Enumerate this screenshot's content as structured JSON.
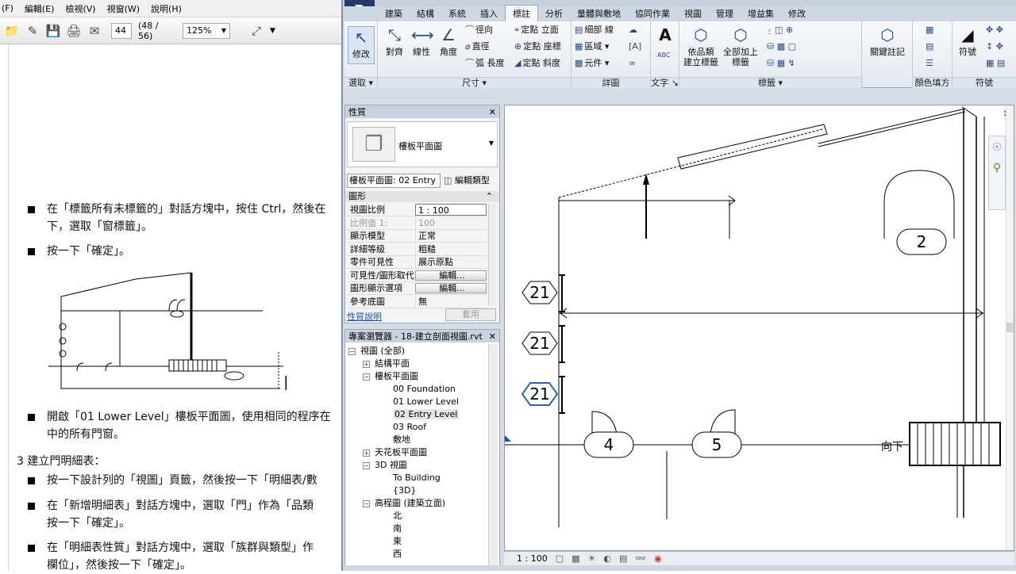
{
  "pdf": {
    "menu": [
      "(F)",
      "編輯(E)",
      "檢視(V)",
      "視窗(W)",
      "說明(H)"
    ],
    "page_number": "44",
    "page_of": "(48 / 56)",
    "zoom": "125%",
    "bullets": [
      {
        "line1": "在「標籤所有未標籤的」對話方塊中，按住 Ctrl，然後在",
        "line2": "下，選取「窗標籤」。"
      },
      {
        "line1": "按一下「確定」。",
        "line2": ""
      },
      {
        "line1": "開啟「01 Lower Level」樓板平面圖，使用相同的程序在",
        "line2": "中的所有門窗。"
      },
      {
        "line1": "按一下設計列的「視圖」頁籤，然後按一下「明細表/數",
        "line2": ""
      },
      {
        "line1": "在「新增明細表」對話方塊中，選取「門」作為「品類",
        "line2": "按一下「確定」。"
      },
      {
        "line1": "在「明細表性質」對話方塊中，選取「族群與類型」作",
        "line2": "欄位」，然後按一下「確定」。"
      }
    ],
    "section_heading": "3 建立門明細表：",
    "section_number": "3"
  },
  "revit": {
    "logo": "R",
    "tabs": [
      "建築",
      "結構",
      "系統",
      "插入",
      "標註",
      "分析",
      "量體與敷地",
      "協同作業",
      "視圖",
      "管理",
      "增益集",
      "修改"
    ],
    "active_tab": "標註",
    "ribbon": {
      "modify": "修改",
      "select": "選取 ▾",
      "dims": [
        "對齊",
        "線性",
        "角度"
      ],
      "dims_small": [
        "徑向",
        "直徑",
        "弧 長度",
        "定點 立面",
        "定點 座標",
        "定點 斜度"
      ],
      "dims_title": "尺寸 ▾",
      "detail": [
        "細部 線",
        "區域 ▾",
        "元件 ▾"
      ],
      "detail_title": "詳圖",
      "text": "文字",
      "text_title": "文字 ↘",
      "tag1": "依品類\n建立標籤",
      "tag2": "全部加上\n標籤",
      "tag_title": "標籤 ▾",
      "keynote": "關鍵註記",
      "color_fill_title": "顏色填方",
      "symbol": "符號",
      "symbol_title": "符號"
    },
    "properties": {
      "title": "性質",
      "type_name": "樓板平面圖",
      "selector": "樓板平面圖: 02 Entry",
      "edit_type": "編輯類型",
      "group": "圖形",
      "rows": [
        {
          "k": "視圖比例",
          "v": "1 : 100"
        },
        {
          "k": "比例值 1:",
          "v": "100"
        },
        {
          "k": "顯示模型",
          "v": "正常"
        },
        {
          "k": "詳細等級",
          "v": "粗糙"
        },
        {
          "k": "零件可見性",
          "v": "展示原點"
        },
        {
          "k": "可見性/圖形取代",
          "v": "編輯..."
        },
        {
          "k": "圖形顯示選項",
          "v": "編輯..."
        },
        {
          "k": "參考底圖",
          "v": "無"
        }
      ],
      "help": "性質說明",
      "apply": "套用"
    },
    "browser": {
      "title": "專案瀏覽器 - 18-建立剖面視圖.rvt",
      "items": [
        {
          "label": "視圖 (全部)",
          "level": 0,
          "ex": "−"
        },
        {
          "label": "結構平面",
          "level": 1,
          "ex": "+"
        },
        {
          "label": "樓板平面圖",
          "level": 1,
          "ex": "−"
        },
        {
          "label": "00 Foundation",
          "level": 2,
          "ex": ""
        },
        {
          "label": "01 Lower Level",
          "level": 2,
          "ex": ""
        },
        {
          "label": "02 Entry Level",
          "level": 2,
          "ex": "",
          "selected": true
        },
        {
          "label": "03 Roof",
          "level": 2,
          "ex": ""
        },
        {
          "label": "敷地",
          "level": 2,
          "ex": ""
        },
        {
          "label": "天花板平面圖",
          "level": 1,
          "ex": "+"
        },
        {
          "label": "3D 視圖",
          "level": 1,
          "ex": "−"
        },
        {
          "label": "To Building",
          "level": 2,
          "ex": ""
        },
        {
          "label": "{3D}",
          "level": 2,
          "ex": ""
        },
        {
          "label": "高程圖 (建築立面)",
          "level": 1,
          "ex": "−"
        },
        {
          "label": "北",
          "level": 2,
          "ex": ""
        },
        {
          "label": "南",
          "level": 2,
          "ex": ""
        },
        {
          "label": "東",
          "level": 2,
          "ex": ""
        },
        {
          "label": "西",
          "level": 2,
          "ex": ""
        }
      ]
    },
    "view": {
      "tags": [
        "21",
        "21",
        "21",
        "2",
        "4",
        "5"
      ],
      "stair_label": "向下",
      "scale": "1 : 100"
    }
  }
}
